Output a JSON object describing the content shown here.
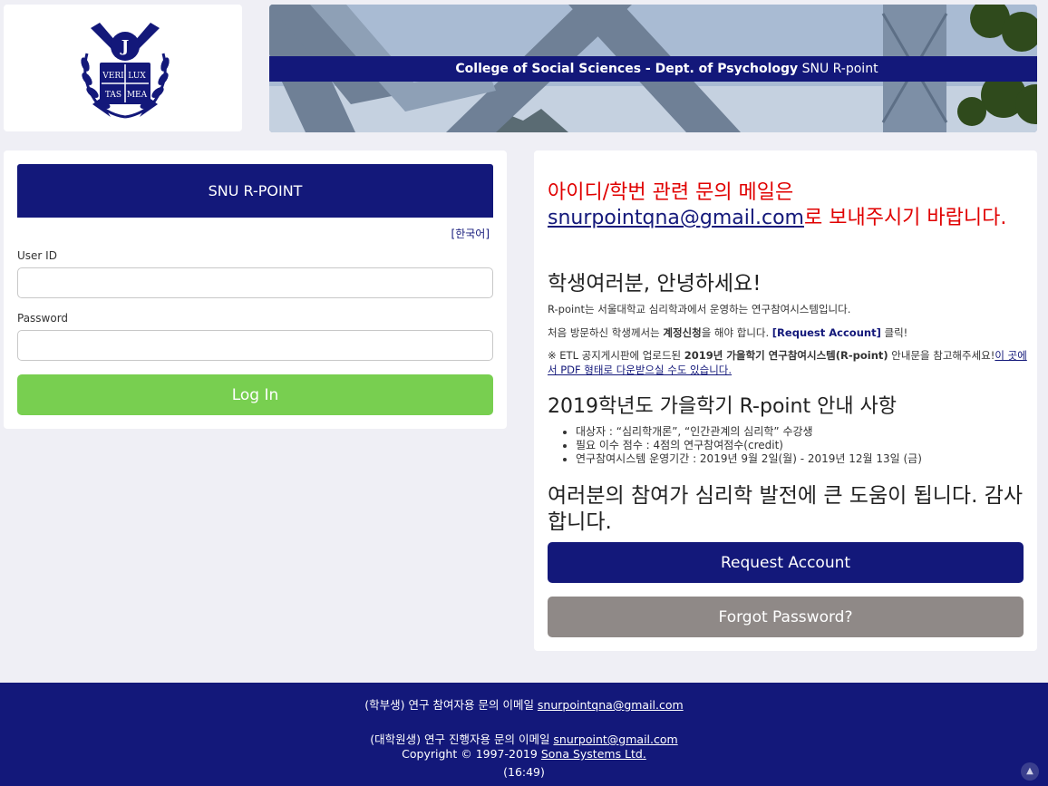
{
  "logo": {
    "seal_text": [
      "VERI",
      "LUX",
      "TAS",
      "MEA"
    ]
  },
  "banner": {
    "title_bold": "College of Social Sciences - Dept. of Psychology",
    "title_rest": " SNU R-point"
  },
  "login": {
    "header": "SNU R-POINT",
    "lang_link": "[한국어]",
    "user_id_label": "User ID",
    "user_id_value": "",
    "password_label": "Password",
    "password_value": "",
    "login_button": "Log In"
  },
  "info": {
    "notice_pre": "아이디/학번 관련 문의 메일은 ",
    "notice_email": "snurpointqna@gmail.com",
    "notice_post": "로 보내주시기 바랍니다.",
    "greeting": "학생여러분, 안녕하세요!",
    "p1": "R-point는 서울대학교 심리학과에서 운영하는 연구참여시스템입니다.",
    "p2_pre": "처음 방문하신 학생께서는 ",
    "p2_bold": "계정신청",
    "p2_mid": "을 해야 합니다. ",
    "p2_link": "[Request Account]",
    "p2_post": " 클릭!",
    "p3_pre": "※ ETL 공지게시판에 업로드된 ",
    "p3_bold": "2019년 가을학기 연구참여시스템(R-point)",
    "p3_mid": " 안내문을 참고해주세요!",
    "p3_link": "이 곳에서 PDF 형태로 다운받으실 수도 있습니다.",
    "guide_title": "2019학년도 가을학기 R-point 안내 사항",
    "guide_items": [
      "대상자 : “심리학개론”, “인간관계의 심리학” 수강생",
      "필요 이수 점수 : 4점의 연구참여점수(credit)",
      "연구참여시스템 운영기간 : 2019년 9월 2일(월) - 2019년 12월 13일 (금)"
    ],
    "thanks": "여러분의 참여가 심리학 발전에 큰 도움이 됩니다. 감사합니다.",
    "request_button": "Request Account",
    "forgot_button": "Forgot Password?"
  },
  "footer": {
    "line1_pre": "(학부생) 연구 참여자용 문의 이메일 ",
    "line1_email": "snurpointqna@gmail.com",
    "line2_pre": "(대학원생) 연구 진행자용 문의 이메일 ",
    "line2_email": "snurpoint@gmail.com",
    "copyright_pre": "Copyright © 1997-2019 ",
    "copyright_link": "Sona Systems Ltd.",
    "time": "(16:49)",
    "to_top_icon": "chevron-up-icon"
  },
  "colors": {
    "navy": "#13187a",
    "green": "#78cf50",
    "red_notice": "#e00000",
    "gray_button": "#8f8987",
    "page_bg": "#efeff5"
  }
}
